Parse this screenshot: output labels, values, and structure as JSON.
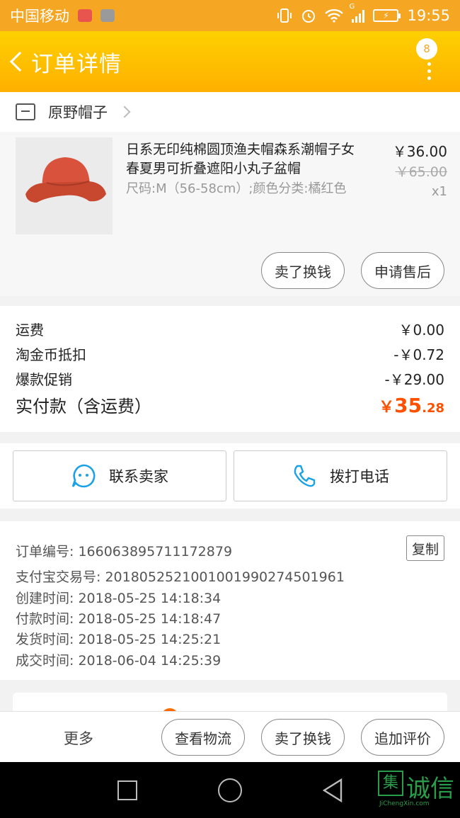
{
  "status_bar": {
    "carrier": "中国移动",
    "time": "19:55",
    "network": "G"
  },
  "header": {
    "title": "订单详情",
    "badge_count": "8"
  },
  "shop": {
    "name": "原野帽子"
  },
  "product": {
    "name": "日系无印纯棉圆顶渔夫帽森系潮帽子女春夏男可折叠遮阳小丸子盆帽",
    "spec": "尺码:M（56-58cm）;颜色分类:橘红色",
    "price": "￥36.00",
    "original_price": "￥65.00",
    "quantity": "x1",
    "sell_button": "卖了换钱",
    "aftersale_button": "申请售后"
  },
  "fees": {
    "shipping_label": "运费",
    "shipping_value": "￥0.00",
    "coin_label": "淘金币抵扣",
    "coin_value": "-￥0.72",
    "promo_label": "爆款促销",
    "promo_value": "-￥29.00",
    "total_label": "实付款（含运费）",
    "total_currency": "￥",
    "total_integer": "35",
    "total_decimal": ".28"
  },
  "contact": {
    "seller_button": "联系卖家",
    "call_button": "拨打电话"
  },
  "order_info": {
    "order_no": "订单编号: 166063895711172879",
    "copy_button": "复制",
    "alipay_no": "支付宝交易号: 2018052521001001990274501961",
    "created": "创建时间: 2018-05-25 14:18:34",
    "paid": "付款时间: 2018-05-25 14:18:47",
    "shipped": "发货时间: 2018-05-25 14:25:21",
    "completed": "成交时间: 2018-06-04 14:25:39"
  },
  "actions": {
    "more": "更多",
    "logistics": "查看物流",
    "sell": "卖了换钱",
    "review": "追加评价"
  },
  "watermark": {
    "logo_char": "集",
    "text": "诚信",
    "url": "JiChengXin.com"
  },
  "colors": {
    "header": "#ffb000",
    "status_bar": "#f5a623",
    "price_accent": "#ff5000",
    "contact_icon": "#1aa1e6"
  }
}
